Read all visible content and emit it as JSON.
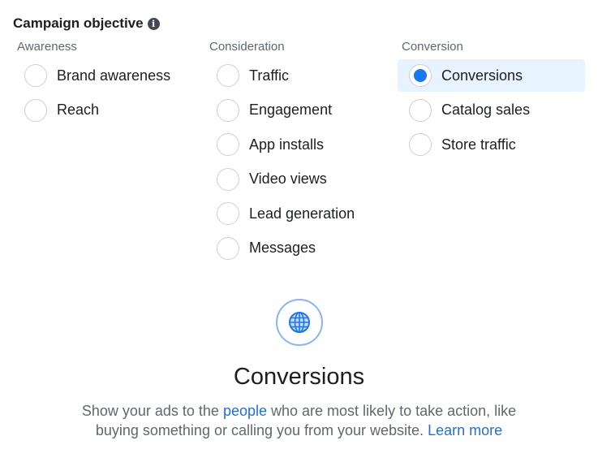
{
  "header": {
    "title": "Campaign objective",
    "info_icon": "info-icon"
  },
  "columns": [
    {
      "heading": "Awareness",
      "options": [
        {
          "label": "Brand awareness",
          "selected": false
        },
        {
          "label": "Reach",
          "selected": false
        }
      ]
    },
    {
      "heading": "Consideration",
      "options": [
        {
          "label": "Traffic",
          "selected": false
        },
        {
          "label": "Engagement",
          "selected": false
        },
        {
          "label": "App installs",
          "selected": false
        },
        {
          "label": "Video views",
          "selected": false
        },
        {
          "label": "Lead generation",
          "selected": false
        },
        {
          "label": "Messages",
          "selected": false
        }
      ]
    },
    {
      "heading": "Conversion",
      "options": [
        {
          "label": "Conversions",
          "selected": true
        },
        {
          "label": "Catalog sales",
          "selected": false
        },
        {
          "label": "Store traffic",
          "selected": false
        }
      ]
    }
  ],
  "detail": {
    "icon": "globe-icon",
    "title": "Conversions",
    "desc_part1": "Show your ads to the ",
    "people_link": "people",
    "desc_part2": " who are most likely to take action, like",
    "desc_line2": "buying something or calling you from your website. ",
    "learn_more": "Learn more"
  },
  "colors": {
    "accent": "#1877f2",
    "selected_bg": "#e7f3ff",
    "link": "#216fdb",
    "muted": "#606770"
  }
}
